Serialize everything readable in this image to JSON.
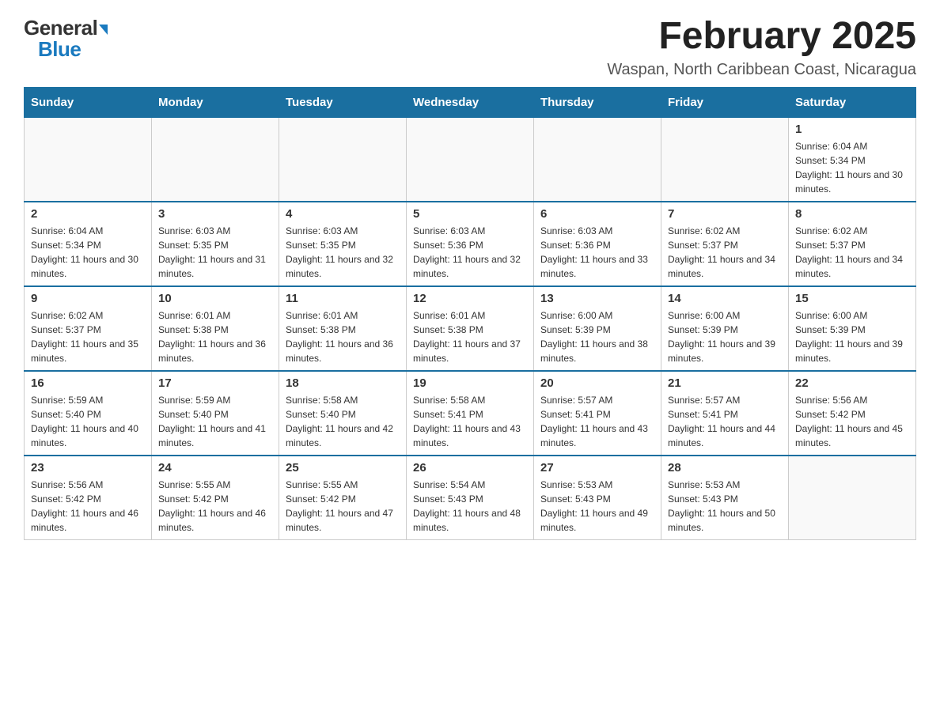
{
  "header": {
    "logo_general": "General",
    "logo_blue": "Blue",
    "month_year": "February 2025",
    "location": "Waspan, North Caribbean Coast, Nicaragua"
  },
  "days_of_week": [
    "Sunday",
    "Monday",
    "Tuesday",
    "Wednesday",
    "Thursday",
    "Friday",
    "Saturday"
  ],
  "weeks": [
    {
      "days": [
        {
          "num": "",
          "info": ""
        },
        {
          "num": "",
          "info": ""
        },
        {
          "num": "",
          "info": ""
        },
        {
          "num": "",
          "info": ""
        },
        {
          "num": "",
          "info": ""
        },
        {
          "num": "",
          "info": ""
        },
        {
          "num": "1",
          "info": "Sunrise: 6:04 AM\nSunset: 5:34 PM\nDaylight: 11 hours and 30 minutes."
        }
      ]
    },
    {
      "days": [
        {
          "num": "2",
          "info": "Sunrise: 6:04 AM\nSunset: 5:34 PM\nDaylight: 11 hours and 30 minutes."
        },
        {
          "num": "3",
          "info": "Sunrise: 6:03 AM\nSunset: 5:35 PM\nDaylight: 11 hours and 31 minutes."
        },
        {
          "num": "4",
          "info": "Sunrise: 6:03 AM\nSunset: 5:35 PM\nDaylight: 11 hours and 32 minutes."
        },
        {
          "num": "5",
          "info": "Sunrise: 6:03 AM\nSunset: 5:36 PM\nDaylight: 11 hours and 32 minutes."
        },
        {
          "num": "6",
          "info": "Sunrise: 6:03 AM\nSunset: 5:36 PM\nDaylight: 11 hours and 33 minutes."
        },
        {
          "num": "7",
          "info": "Sunrise: 6:02 AM\nSunset: 5:37 PM\nDaylight: 11 hours and 34 minutes."
        },
        {
          "num": "8",
          "info": "Sunrise: 6:02 AM\nSunset: 5:37 PM\nDaylight: 11 hours and 34 minutes."
        }
      ]
    },
    {
      "days": [
        {
          "num": "9",
          "info": "Sunrise: 6:02 AM\nSunset: 5:37 PM\nDaylight: 11 hours and 35 minutes."
        },
        {
          "num": "10",
          "info": "Sunrise: 6:01 AM\nSunset: 5:38 PM\nDaylight: 11 hours and 36 minutes."
        },
        {
          "num": "11",
          "info": "Sunrise: 6:01 AM\nSunset: 5:38 PM\nDaylight: 11 hours and 36 minutes."
        },
        {
          "num": "12",
          "info": "Sunrise: 6:01 AM\nSunset: 5:38 PM\nDaylight: 11 hours and 37 minutes."
        },
        {
          "num": "13",
          "info": "Sunrise: 6:00 AM\nSunset: 5:39 PM\nDaylight: 11 hours and 38 minutes."
        },
        {
          "num": "14",
          "info": "Sunrise: 6:00 AM\nSunset: 5:39 PM\nDaylight: 11 hours and 39 minutes."
        },
        {
          "num": "15",
          "info": "Sunrise: 6:00 AM\nSunset: 5:39 PM\nDaylight: 11 hours and 39 minutes."
        }
      ]
    },
    {
      "days": [
        {
          "num": "16",
          "info": "Sunrise: 5:59 AM\nSunset: 5:40 PM\nDaylight: 11 hours and 40 minutes."
        },
        {
          "num": "17",
          "info": "Sunrise: 5:59 AM\nSunset: 5:40 PM\nDaylight: 11 hours and 41 minutes."
        },
        {
          "num": "18",
          "info": "Sunrise: 5:58 AM\nSunset: 5:40 PM\nDaylight: 11 hours and 42 minutes."
        },
        {
          "num": "19",
          "info": "Sunrise: 5:58 AM\nSunset: 5:41 PM\nDaylight: 11 hours and 43 minutes."
        },
        {
          "num": "20",
          "info": "Sunrise: 5:57 AM\nSunset: 5:41 PM\nDaylight: 11 hours and 43 minutes."
        },
        {
          "num": "21",
          "info": "Sunrise: 5:57 AM\nSunset: 5:41 PM\nDaylight: 11 hours and 44 minutes."
        },
        {
          "num": "22",
          "info": "Sunrise: 5:56 AM\nSunset: 5:42 PM\nDaylight: 11 hours and 45 minutes."
        }
      ]
    },
    {
      "days": [
        {
          "num": "23",
          "info": "Sunrise: 5:56 AM\nSunset: 5:42 PM\nDaylight: 11 hours and 46 minutes."
        },
        {
          "num": "24",
          "info": "Sunrise: 5:55 AM\nSunset: 5:42 PM\nDaylight: 11 hours and 46 minutes."
        },
        {
          "num": "25",
          "info": "Sunrise: 5:55 AM\nSunset: 5:42 PM\nDaylight: 11 hours and 47 minutes."
        },
        {
          "num": "26",
          "info": "Sunrise: 5:54 AM\nSunset: 5:43 PM\nDaylight: 11 hours and 48 minutes."
        },
        {
          "num": "27",
          "info": "Sunrise: 5:53 AM\nSunset: 5:43 PM\nDaylight: 11 hours and 49 minutes."
        },
        {
          "num": "28",
          "info": "Sunrise: 5:53 AM\nSunset: 5:43 PM\nDaylight: 11 hours and 50 minutes."
        },
        {
          "num": "",
          "info": ""
        }
      ]
    }
  ]
}
